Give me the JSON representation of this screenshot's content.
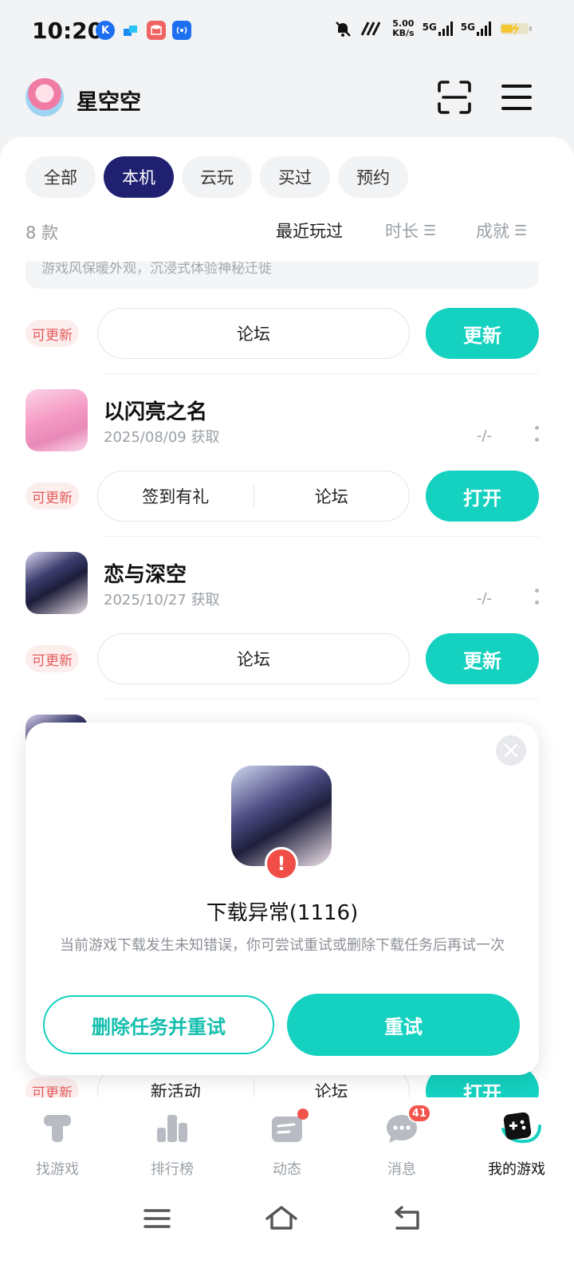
{
  "status_bar": {
    "time": "10:20",
    "net_speed_value": "5.00",
    "net_speed_unit": "KB/s",
    "signal1_label": "5G",
    "signal2_label": "5G"
  },
  "header": {
    "username": "星空空"
  },
  "filters": [
    "全部",
    "本机",
    "云玩",
    "买过",
    "预约"
  ],
  "list_meta": {
    "count": "8 款",
    "sort_recent": "最近玩过",
    "sort_duration": "时长",
    "sort_achievement": "成就"
  },
  "partial_description": "游戏风保暖外观，沉浸式体验神秘迁徙",
  "rows": [
    {
      "badge": "可更新",
      "actions": [
        "论坛"
      ],
      "button": "更新"
    },
    {
      "badge": "可更新",
      "actions": [
        "签到有礼",
        "论坛"
      ],
      "button": "打开"
    },
    {
      "badge": "可更新",
      "actions": [
        "论坛"
      ],
      "button": "更新"
    },
    {
      "badge": "可更新",
      "actions": [
        "新活动",
        "论坛"
      ],
      "button": "打开"
    }
  ],
  "games": [
    {
      "name": "以闪亮之名",
      "acquired": "2025/08/09 获取",
      "playtime": "-/-"
    },
    {
      "name": "恋与深空",
      "acquired": "2025/10/27 获取",
      "playtime": "-/-"
    }
  ],
  "dialog": {
    "title": "下载异常(1116)",
    "message": "当前游戏下载发生未知错误，你可尝试重试或删除下载任务后再试一次",
    "secondary_button": "删除任务并重试",
    "primary_button": "重试"
  },
  "tabs": [
    {
      "label": "找游戏"
    },
    {
      "label": "排行榜"
    },
    {
      "label": "动态"
    },
    {
      "label": "消息",
      "badge": "41"
    },
    {
      "label": "我的游戏"
    }
  ],
  "colors": {
    "accent": "#14d1c0",
    "active_chip": "#1f2070",
    "update_badge_text": "#e35b5b",
    "notification": "#f2544c"
  }
}
